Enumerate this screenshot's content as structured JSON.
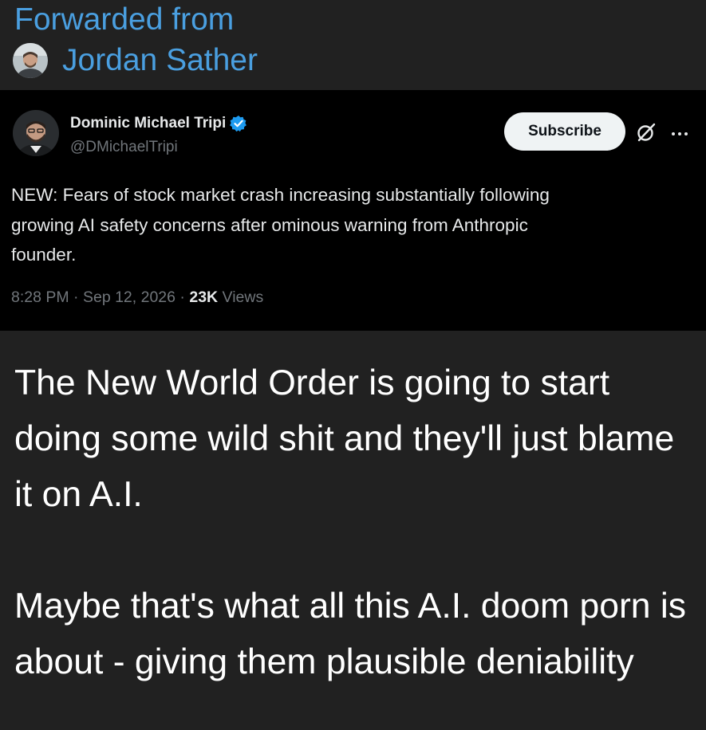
{
  "forward": {
    "label": "Forwarded from",
    "author": "Jordan Sather"
  },
  "tweet": {
    "author_name": "Dominic Michael Tripi",
    "handle": "@DMichaelTripi",
    "subscribe_label": "Subscribe",
    "text": "NEW: Fears of stock market crash increasing substantially following\ngrowing AI safety concerns after ominous warning from Anthropic\nfounder.",
    "time": "8:28 PM",
    "date": "Sep 12, 2026",
    "separator": "·",
    "views_count": "23K",
    "views_label": "Views",
    "icons": {
      "verified": "verified-badge-icon",
      "grok": "grok-icon",
      "more": "more-options-icon"
    }
  },
  "post": {
    "paragraph1": "The New World Order is going to start doing some wild shit and they'll just blame it on A.I.",
    "paragraph2": "Maybe that's what all this A.I. doom porn is about - giving them plausible deniability"
  },
  "colors": {
    "background": "#212121",
    "link_blue": "#4a9fe0",
    "tweet_background": "#000000",
    "verified_blue": "#1d9bf0"
  }
}
